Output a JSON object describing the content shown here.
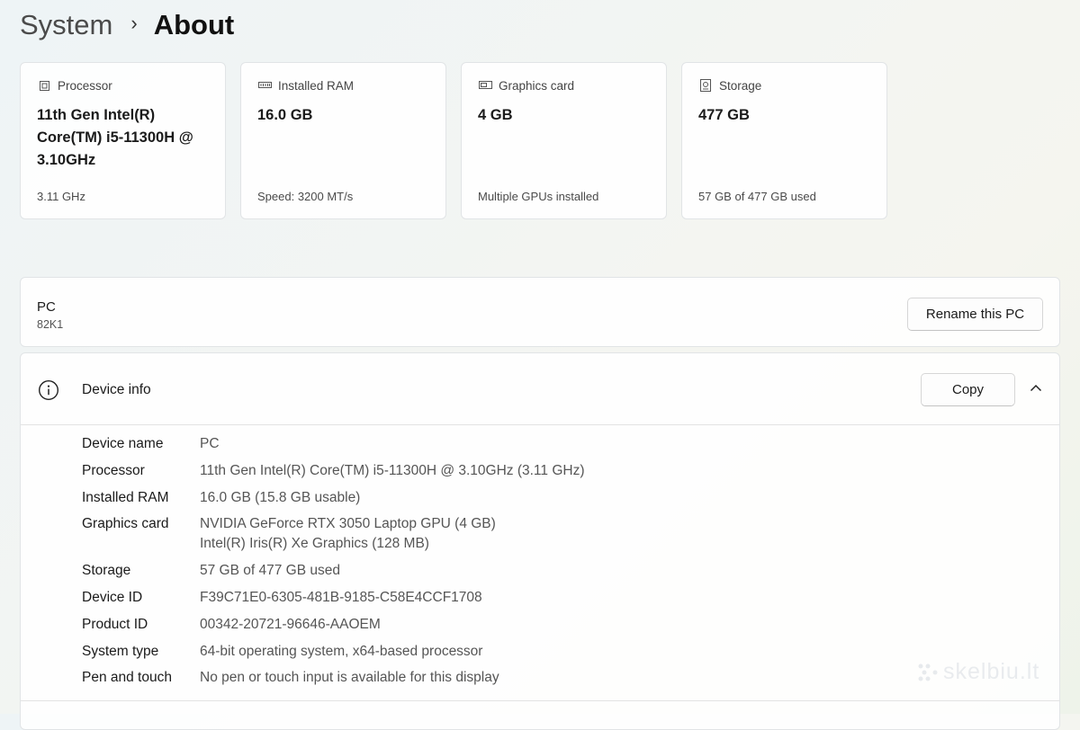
{
  "breadcrumb": {
    "parent": "System",
    "separator": "›",
    "current": "About"
  },
  "cards": [
    {
      "icon": "processor-icon",
      "label": "Processor",
      "value": "11th Gen Intel(R) Core(TM) i5-11300H @ 3.10GHz",
      "sub": "3.11 GHz"
    },
    {
      "icon": "ram-icon",
      "label": "Installed RAM",
      "value": "16.0 GB",
      "sub": "Speed: 3200 MT/s"
    },
    {
      "icon": "graphics-card-icon",
      "label": "Graphics card",
      "value": "4 GB",
      "sub": "Multiple GPUs installed"
    },
    {
      "icon": "storage-icon",
      "label": "Storage",
      "value": "477 GB",
      "sub": "57 GB of 477 GB used"
    }
  ],
  "pc": {
    "name": "PC",
    "model": "82K1",
    "rename_label": "Rename this PC"
  },
  "device_info": {
    "title": "Device info",
    "copy_label": "Copy",
    "icon": "info-icon",
    "specs": [
      {
        "label": "Device name",
        "value": "PC"
      },
      {
        "label": "Processor",
        "value": "11th Gen Intel(R) Core(TM) i5-11300H @ 3.10GHz (3.11 GHz)"
      },
      {
        "label": "Installed RAM",
        "value": "16.0 GB (15.8 GB usable)"
      },
      {
        "label": "Graphics card",
        "value": "NVIDIA GeForce RTX 3050 Laptop GPU (4 GB)",
        "value2": "Intel(R) Iris(R) Xe Graphics (128 MB)"
      },
      {
        "label": "Storage",
        "value": "57 GB of 477 GB used"
      },
      {
        "label": "Device ID",
        "value": "F39C71E0-6305-481B-9185-C58E4CCF1708"
      },
      {
        "label": "Product ID",
        "value": "00342-20721-96646-AAOEM"
      },
      {
        "label": "System type",
        "value": "64-bit operating system, x64-based processor"
      },
      {
        "label": "Pen and touch",
        "value": "No pen or touch input is available for this display"
      }
    ]
  },
  "watermark": {
    "text": "skelbiu.lt"
  }
}
